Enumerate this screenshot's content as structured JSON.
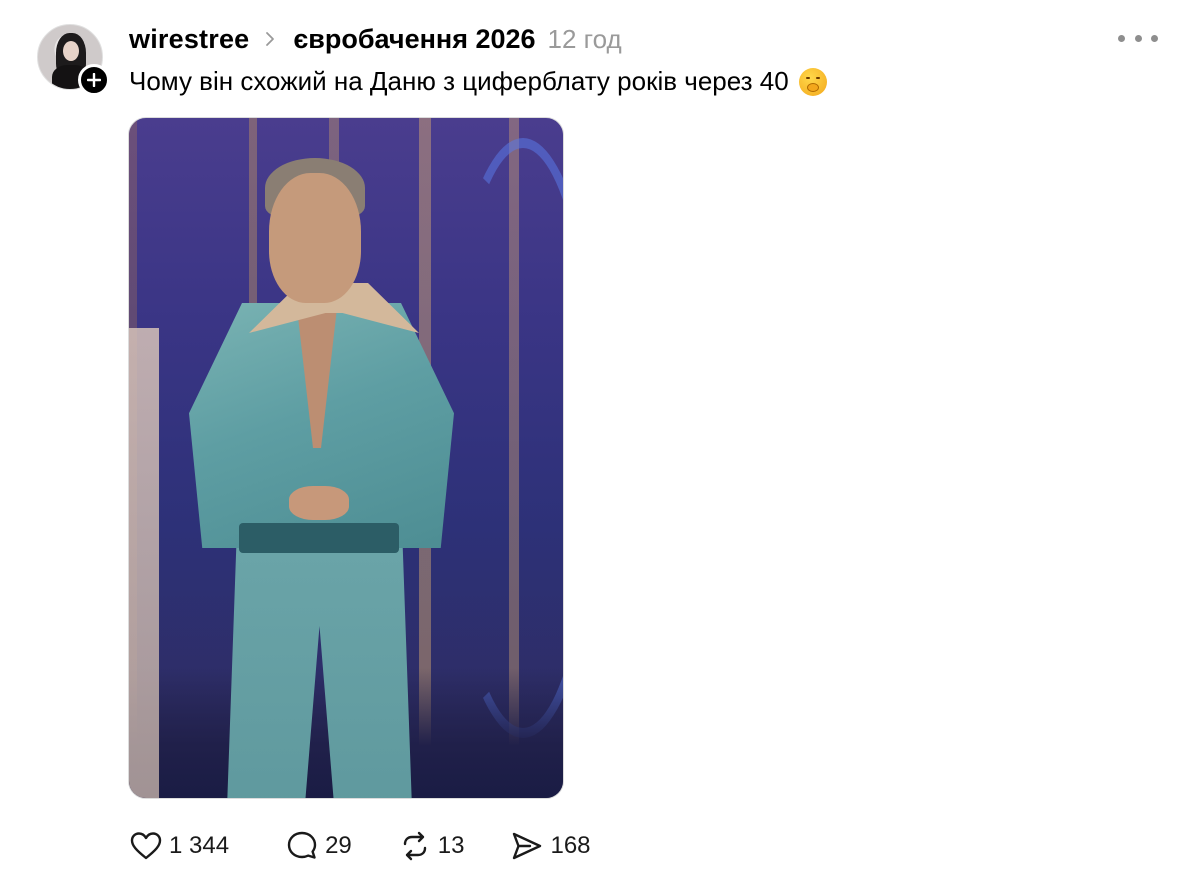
{
  "post": {
    "username": "wirestree",
    "topic": "євробачення 2026",
    "time": "12 год",
    "text": "Чому він схожий на Даню з циферблату років через 40",
    "emoji": "hushed-face-emoji",
    "avatar_badge": "plus-icon",
    "actions": {
      "likes": "1 344",
      "replies": "29",
      "reposts": "13",
      "shares": "168"
    },
    "icons": [
      "heart-icon",
      "comment-icon",
      "repost-icon",
      "send-icon",
      "more-icon",
      "chevron-right-icon"
    ],
    "colors": {
      "text": "#000000",
      "muted": "#9a9a9a",
      "background": "#ffffff"
    }
  }
}
